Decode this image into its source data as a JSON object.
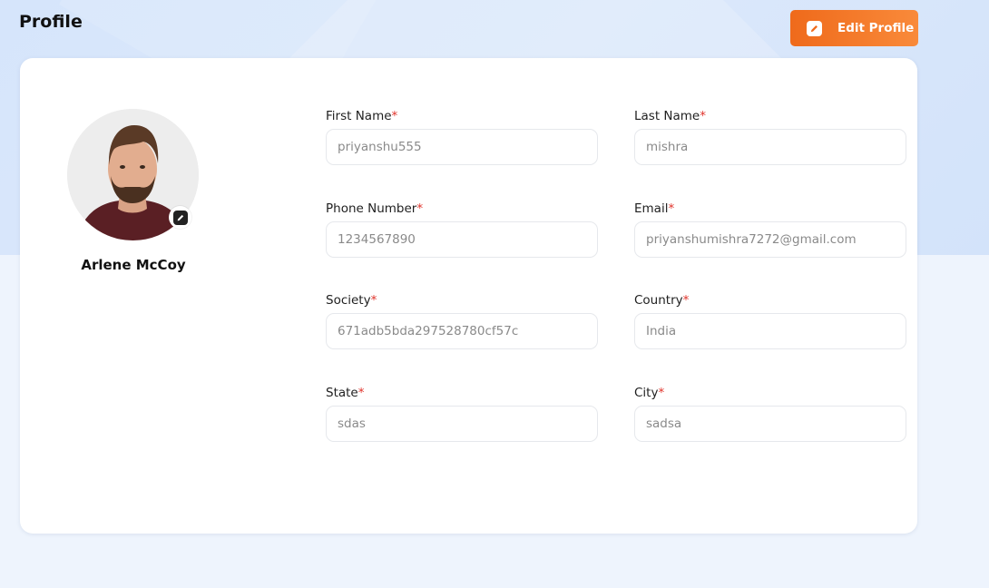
{
  "header": {
    "title": "Profile",
    "edit_button_label": "Edit Profile"
  },
  "profile": {
    "name": "Arlene McCoy",
    "avatar_icon": "person-photo"
  },
  "colors": {
    "accent_start": "#ef6a1b",
    "accent_end": "#f98a3a",
    "required": "#e0332b"
  },
  "fields": [
    {
      "label": "First Name",
      "required": "*",
      "value": "priyanshu555"
    },
    {
      "label": "Last Name",
      "required": "*",
      "value": "mishra"
    },
    {
      "label": "Phone Number",
      "required": "*",
      "value": "1234567890"
    },
    {
      "label": "Email",
      "required": "*",
      "value": "priyanshumishra7272@gmail.com"
    },
    {
      "label": "Society",
      "required": "*",
      "value": "671adb5bda297528780cf57c"
    },
    {
      "label": "Country",
      "required": "*",
      "value": "India"
    },
    {
      "label": "State",
      "required": "*",
      "value": "sdas"
    },
    {
      "label": "City",
      "required": "*",
      "value": "sadsa"
    }
  ]
}
